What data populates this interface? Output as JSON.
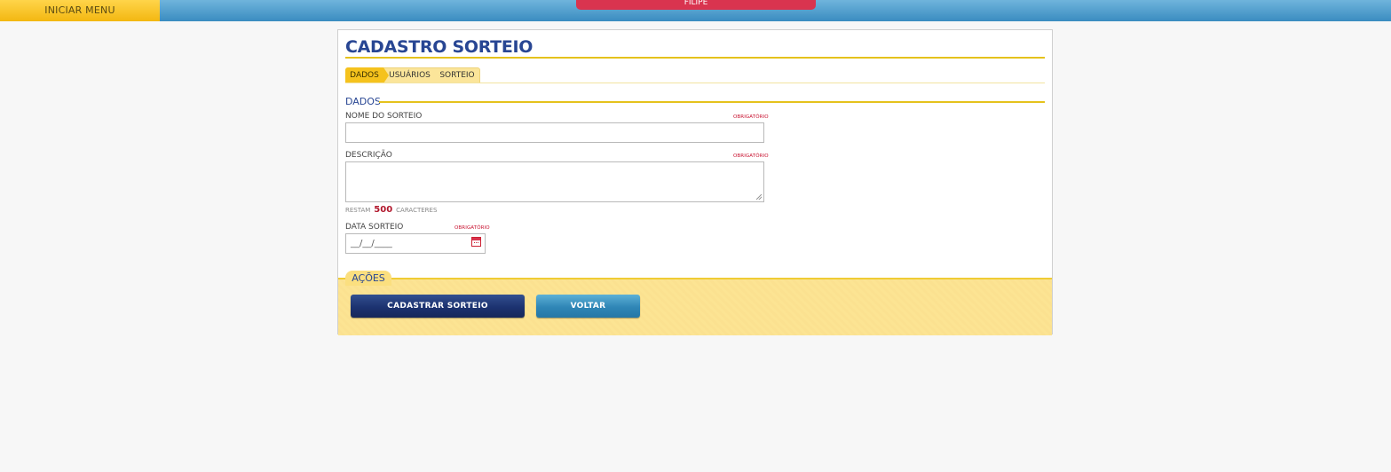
{
  "topbar": {
    "menu_label": "INICIAR MENU",
    "user_name": "FILIPE"
  },
  "form": {
    "title": "CADASTRO SORTEIO",
    "tabs": [
      {
        "label": "DADOS",
        "active": true
      },
      {
        "label": "USUÁRIOS",
        "active": false
      },
      {
        "label": "SORTEIO",
        "active": false
      }
    ],
    "section_title": "DADOS",
    "required_label": "OBRIGATÓRIO",
    "fields": {
      "nome": {
        "label": "NOME DO SORTEIO",
        "value": ""
      },
      "descricao": {
        "label": "DESCRIÇÃO",
        "value": ""
      },
      "data": {
        "label": "DATA SORTEIO",
        "value": "__/__/____"
      }
    },
    "counter": {
      "prefix": "RESTAM",
      "remaining": "500",
      "suffix": "CARACTERES"
    }
  },
  "actions": {
    "title": "AÇÕES",
    "submit_label": "CADASTRAR SORTEIO",
    "back_label": "VOLTAR"
  },
  "colors": {
    "accent_blue": "#284693",
    "accent_yellow": "#f5c21d",
    "required_red": "#c8102e"
  },
  "icons": [
    "calendar-icon",
    "resize-grip-icon"
  ]
}
